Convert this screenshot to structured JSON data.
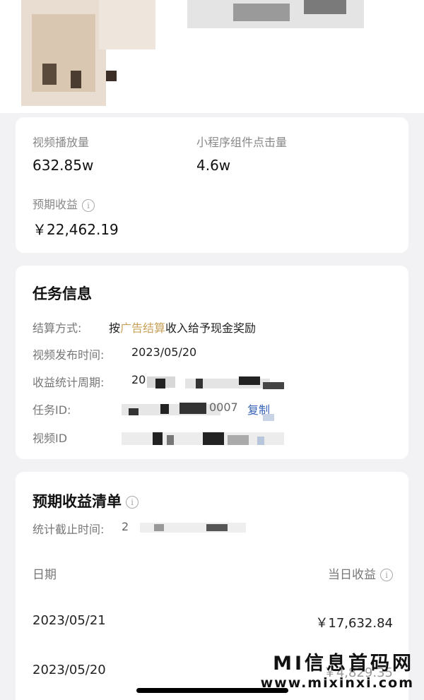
{
  "stats": {
    "views_label": "视频播放量",
    "views_value": "632.85w",
    "clicks_label": "小程序组件点击量",
    "clicks_value": "4.6w",
    "expected_label": "预期收益",
    "expected_value": "￥22,462.19"
  },
  "task": {
    "title": "任务信息",
    "settle_label": "结算方式:",
    "settle_prefix": "按",
    "settle_highlight": "广告结算",
    "settle_suffix": "收入给予现金奖励",
    "publish_label": "视频发布时间:",
    "publish_value": "2023/05/20",
    "period_label": "收益统计周期:",
    "period_value_partial": "20",
    "task_id_label": "任务ID:",
    "task_id_partial": "0007",
    "copy_label": "复制",
    "video_id_label": "视频ID"
  },
  "ledger": {
    "title": "预期收益清单",
    "cutoff_label": "统计截止时间:",
    "cutoff_partial": "2",
    "col_date": "日期",
    "col_income": "当日收益",
    "rows": [
      {
        "date": "2023/05/21",
        "amount": "￥17,632.84"
      },
      {
        "date": "2023/05/20",
        "amount": "￥4,829.35"
      }
    ]
  },
  "watermark": {
    "line1": "MI信息首码网",
    "line2": "www.mixinxi.com"
  }
}
